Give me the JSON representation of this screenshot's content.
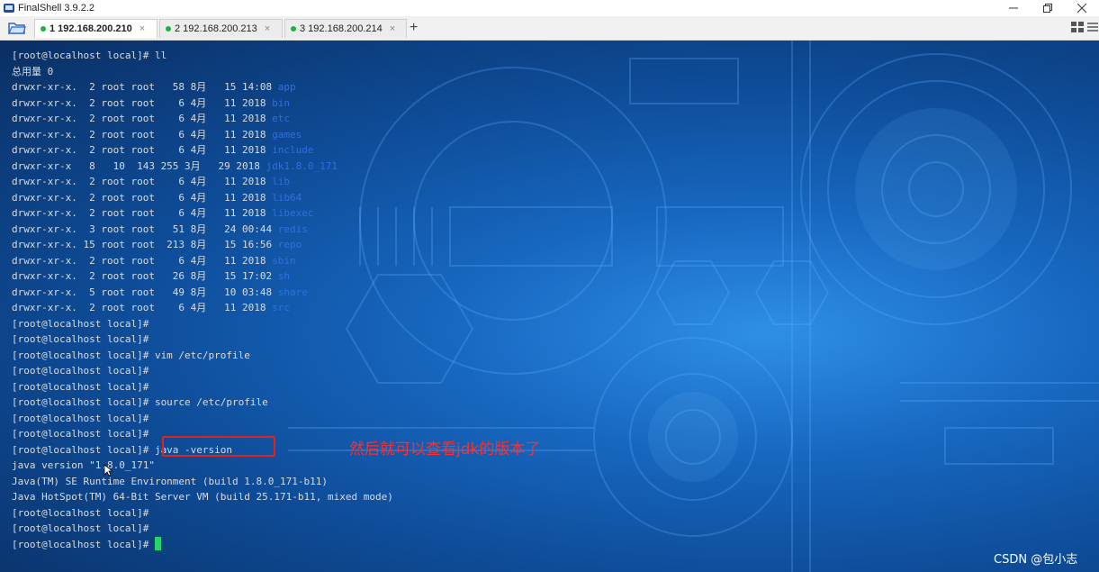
{
  "window": {
    "title": "FinalShell 3.9.2.2"
  },
  "tabs": [
    {
      "label": "1 192.168.200.210",
      "close": "×"
    },
    {
      "label": "2 192.168.200.213",
      "close": "×"
    },
    {
      "label": "3 192.168.200.214",
      "close": "×"
    }
  ],
  "add_tab": "+",
  "terminal": {
    "lines": [
      {
        "text": "[root@localhost local]# ll"
      },
      {
        "text": "总用量 0"
      },
      {
        "text": "drwxr-xr-x.  2 root root   58 8月   15 14:08 ",
        "dir": "app"
      },
      {
        "text": "drwxr-xr-x.  2 root root    6 4月   11 2018 ",
        "dir": "bin"
      },
      {
        "text": "drwxr-xr-x.  2 root root    6 4月   11 2018 ",
        "dir": "etc"
      },
      {
        "text": "drwxr-xr-x.  2 root root    6 4月   11 2018 ",
        "dir": "games"
      },
      {
        "text": "drwxr-xr-x.  2 root root    6 4月   11 2018 ",
        "dir": "include"
      },
      {
        "text": "drwxr-xr-x   8   10  143 255 3月   29 2018 ",
        "dir": "jdk1.8.0_171"
      },
      {
        "text": "drwxr-xr-x.  2 root root    6 4月   11 2018 ",
        "dir": "lib"
      },
      {
        "text": "drwxr-xr-x.  2 root root    6 4月   11 2018 ",
        "dir": "lib64"
      },
      {
        "text": "drwxr-xr-x.  2 root root    6 4月   11 2018 ",
        "dir": "libexec"
      },
      {
        "text": "drwxr-xr-x.  3 root root   51 8月   24 00:44 ",
        "dir": "redis"
      },
      {
        "text": "drwxr-xr-x. 15 root root  213 8月   15 16:56 ",
        "dir": "repo"
      },
      {
        "text": "drwxr-xr-x.  2 root root    6 4月   11 2018 ",
        "dir": "sbin"
      },
      {
        "text": "drwxr-xr-x.  2 root root   26 8月   15 17:02 ",
        "dir": "sh"
      },
      {
        "text": "drwxr-xr-x.  5 root root   49 8月   10 03:48 ",
        "dir": "share"
      },
      {
        "text": "drwxr-xr-x.  2 root root    6 4月   11 2018 ",
        "dir": "src"
      },
      {
        "text": "[root@localhost local]#"
      },
      {
        "text": "[root@localhost local]#"
      },
      {
        "text": "[root@localhost local]# vim /etc/profile"
      },
      {
        "text": "[root@localhost local]#"
      },
      {
        "text": "[root@localhost local]#"
      },
      {
        "text": "[root@localhost local]# source /etc/profile"
      },
      {
        "text": "[root@localhost local]#"
      },
      {
        "text": "[root@localhost local]#"
      },
      {
        "text": "[root@localhost local]# java -version"
      },
      {
        "text": "java version \"1.8.0_171\""
      },
      {
        "text": "Java(TM) SE Runtime Environment (build 1.8.0_171-b11)"
      },
      {
        "text": "Java HotSpot(TM) 64-Bit Server VM (build 25.171-b11, mixed mode)"
      },
      {
        "text": "[root@localhost local]#"
      },
      {
        "text": "[root@localhost local]#"
      },
      {
        "text": "[root@localhost local]# ",
        "cursor": true
      }
    ]
  },
  "annotation": "然后就可以查看jdk的版本了",
  "watermark": "CSDN @包小志",
  "colors": {
    "dir_color": "#2f6fe0",
    "cursor": "#27d36b",
    "highlight": "#e0241b"
  }
}
